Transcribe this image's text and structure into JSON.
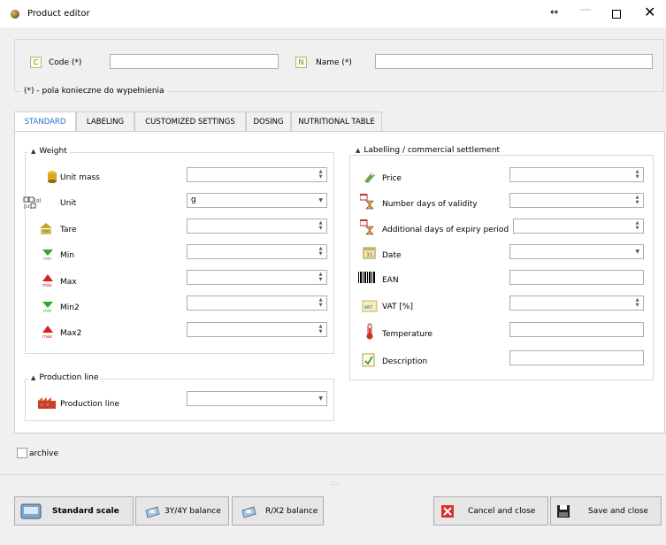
{
  "window": {
    "title": "Product editor",
    "resize_glyph": "↔",
    "min_glyph": "—",
    "close_glyph": "✕"
  },
  "header": {
    "code_label": "Code (*)",
    "name_label": "Name (*)",
    "code_value": "",
    "name_value": "",
    "required_note": "(*) - pola konieczne do wypełnienia"
  },
  "tabs": [
    {
      "label": "STANDARD",
      "active": true
    },
    {
      "label": "LABELING",
      "active": false
    },
    {
      "label": "CUSTOMIZED SETTINGS",
      "active": false
    },
    {
      "label": "DOSING",
      "active": false
    },
    {
      "label": "NUTRITIONAL TABLE",
      "active": false
    }
  ],
  "weight": {
    "title": "Weight",
    "fields": [
      {
        "label": "Unit mass",
        "value": "",
        "control": "spin",
        "icon": "weight-icon"
      },
      {
        "label": "Unit",
        "value": "g",
        "control": "dropdown",
        "icon": "unit-icon"
      },
      {
        "label": "Tare",
        "value": "",
        "control": "spin",
        "icon": "tare-icon"
      },
      {
        "label": "Min",
        "value": "",
        "control": "spin",
        "icon": "min-arrow-icon"
      },
      {
        "label": "Max",
        "value": "",
        "control": "spin",
        "icon": "max-arrow-icon"
      },
      {
        "label": "Min2",
        "value": "",
        "control": "spin",
        "icon": "min-arrow-icon"
      },
      {
        "label": "Max2",
        "value": "",
        "control": "spin",
        "icon": "max-arrow-icon"
      }
    ]
  },
  "production": {
    "title": "Production line",
    "field_label": "Production line",
    "value": ""
  },
  "labelling": {
    "title": "Labelling / commercial settlement",
    "fields": [
      {
        "label": "Price",
        "value": "",
        "control": "spin",
        "icon": "price-tag-icon"
      },
      {
        "label": "Number days of validity",
        "value": "",
        "control": "spin",
        "icon": "hourglass-calendar-icon"
      },
      {
        "label": "Additional days of expiry period",
        "value": "",
        "control": "spin",
        "icon": "hourglass-calendar-icon"
      },
      {
        "label": "Date",
        "value": "",
        "control": "dropdown",
        "icon": "calendar-icon"
      },
      {
        "label": "EAN",
        "value": "",
        "control": "text",
        "icon": "barcode-icon"
      },
      {
        "label": "VAT [%]",
        "value": "",
        "control": "spin",
        "icon": "vat-icon"
      },
      {
        "label": "Temperature",
        "value": "",
        "control": "text",
        "icon": "thermometer-icon"
      },
      {
        "label": "Description",
        "value": "",
        "control": "text",
        "icon": "description-icon"
      }
    ]
  },
  "archive_label": "archive",
  "buttons": {
    "standard_scale": "Standard scale",
    "balance_3y4y": "3Y/4Y balance",
    "balance_rx2": "R/X2 balance",
    "cancel": "Cancel and close",
    "save": "Save and close"
  },
  "colors": {
    "accent": "#2a6fd6",
    "panel": "#ffffff",
    "chrome": "#f0f0f0",
    "cancel_red": "#d9302a"
  }
}
